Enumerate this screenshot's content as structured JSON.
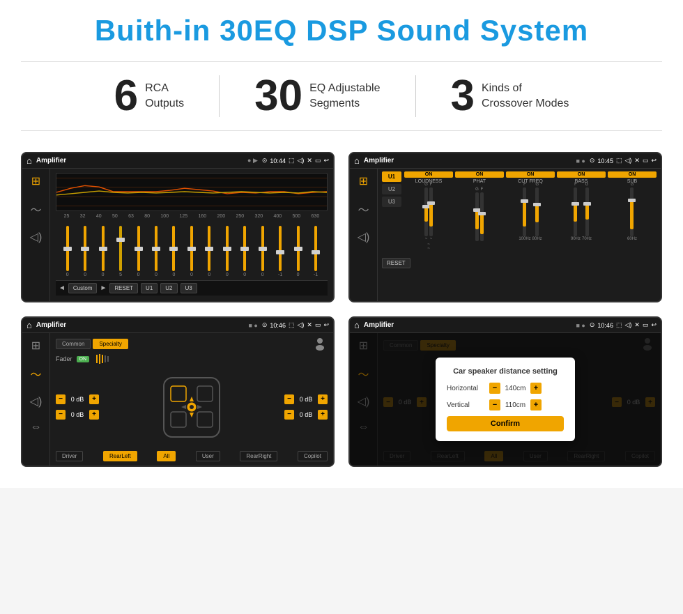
{
  "page": {
    "title": "Buith-in 30EQ DSP Sound System",
    "stats": [
      {
        "number": "6",
        "label": "RCA\nOutputs"
      },
      {
        "number": "30",
        "label": "EQ Adjustable\nSegments"
      },
      {
        "number": "3",
        "label": "Kinds of\nCrossover Modes"
      }
    ]
  },
  "screens": {
    "screen1": {
      "status": {
        "title": "Amplifier",
        "time": "10:44"
      },
      "eq_freqs": [
        "25",
        "32",
        "40",
        "50",
        "63",
        "80",
        "100",
        "125",
        "160",
        "200",
        "250",
        "320",
        "400",
        "500",
        "630"
      ],
      "eq_values": [
        "0",
        "0",
        "0",
        "5",
        "0",
        "0",
        "0",
        "0",
        "0",
        "0",
        "0",
        "0",
        "-1",
        "0",
        "-1"
      ],
      "eq_preset": "Custom",
      "eq_buttons": [
        "RESET",
        "U1",
        "U2",
        "U3"
      ]
    },
    "screen2": {
      "status": {
        "title": "Amplifier",
        "time": "10:45"
      },
      "presets": [
        "U1",
        "U2",
        "U3"
      ],
      "channels": [
        "LOUDNESS",
        "PHAT",
        "CUT FREQ",
        "BASS",
        "SUB"
      ],
      "reset_label": "RESET"
    },
    "screen3": {
      "status": {
        "title": "Amplifier",
        "time": "10:46"
      },
      "tabs": [
        "Common",
        "Specialty"
      ],
      "active_tab": "Specialty",
      "fader_label": "Fader",
      "fader_on": "ON",
      "db_values": [
        "0 dB",
        "0 dB",
        "0 dB",
        "0 dB"
      ],
      "bottom_btns": [
        "Driver",
        "RearLeft",
        "All",
        "User",
        "RearRight",
        "Copilot"
      ]
    },
    "screen4": {
      "status": {
        "title": "Amplifier",
        "time": "10:46"
      },
      "tabs": [
        "Common",
        "Specialty"
      ],
      "active_tab": "Specialty",
      "dialog": {
        "title": "Car speaker distance setting",
        "fields": [
          {
            "label": "Horizontal",
            "value": "140cm"
          },
          {
            "label": "Vertical",
            "value": "110cm"
          }
        ],
        "confirm_label": "Confirm"
      },
      "db_values": [
        "0 dB",
        "0 dB"
      ],
      "bottom_btns": [
        "Driver",
        "RearLeft",
        "All",
        "User",
        "RearRight",
        "Copilot"
      ]
    }
  },
  "icons": {
    "home": "⌂",
    "settings_sliders": "⚙",
    "waveform": "〜",
    "volume": "◁)",
    "back": "↩",
    "play": "▶",
    "pause": "▐▐",
    "prev": "◄",
    "next": "►",
    "location": "⊙",
    "camera": "⬚",
    "speaker": "♪"
  }
}
